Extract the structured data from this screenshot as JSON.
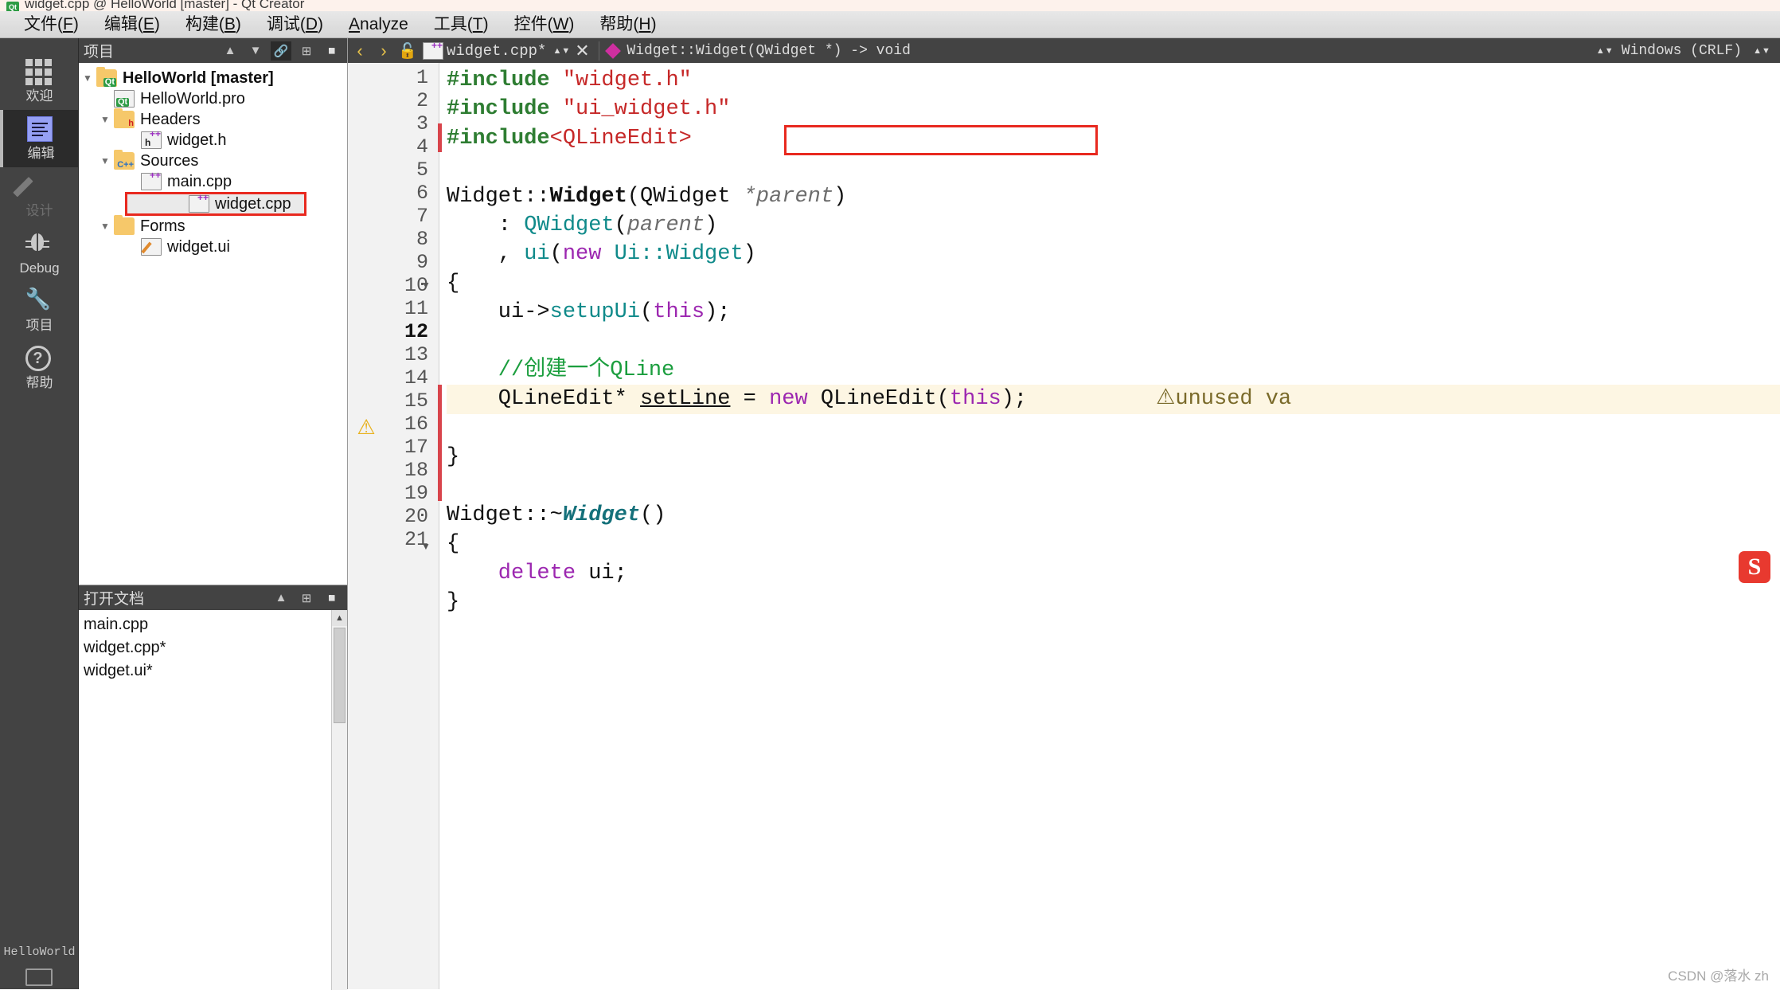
{
  "window": {
    "title": "widget.cpp @ HelloWorld [master] - Qt Creator",
    "app_icon": "qt-logo-icon"
  },
  "menubar": {
    "items": [
      {
        "label": "文件(F)",
        "mnemonic": "F"
      },
      {
        "label": "编辑(E)",
        "mnemonic": "E"
      },
      {
        "label": "构建(B)",
        "mnemonic": "B"
      },
      {
        "label": "调试(D)",
        "mnemonic": "D"
      },
      {
        "label": "Analyze",
        "mnemonic": "A"
      },
      {
        "label": "工具(T)",
        "mnemonic": "T"
      },
      {
        "label": "控件(W)",
        "mnemonic": "W"
      },
      {
        "label": "帮助(H)",
        "mnemonic": "H"
      }
    ]
  },
  "modebar": {
    "items": [
      {
        "label": "欢迎",
        "icon": "grid-icon",
        "state": "normal"
      },
      {
        "label": "编辑",
        "icon": "edit-document-icon",
        "state": "active"
      },
      {
        "label": "设计",
        "icon": "pencil-icon",
        "state": "disabled"
      },
      {
        "label": "Debug",
        "icon": "bug-icon",
        "state": "normal"
      },
      {
        "label": "项目",
        "icon": "wrench-icon",
        "state": "normal"
      },
      {
        "label": "帮助",
        "icon": "question-mark-icon",
        "state": "normal"
      }
    ],
    "kit_label": "HelloWorld"
  },
  "project_panel": {
    "header_title": "项目",
    "header_icons": [
      "updown-arrows-icon",
      "filter-icon",
      "link-icon",
      "split-icon",
      "close-panel-icon"
    ],
    "tree": [
      {
        "label": "HelloWorld [master]",
        "icon": "qt-project-folder-icon",
        "depth": 0,
        "expanded": true,
        "bold": true
      },
      {
        "label": "HelloWorld.pro",
        "icon": "qt-pro-file-icon",
        "depth": 1,
        "bold": false
      },
      {
        "label": "Headers",
        "icon": "headers-folder-icon",
        "depth": 1,
        "expanded": true,
        "bold": false
      },
      {
        "label": "widget.h",
        "icon": "h-file-icon",
        "depth": 2,
        "bold": false
      },
      {
        "label": "Sources",
        "icon": "sources-folder-icon",
        "depth": 1,
        "expanded": true,
        "bold": false
      },
      {
        "label": "main.cpp",
        "icon": "cpp-file-icon",
        "depth": 2,
        "bold": false
      },
      {
        "label": "widget.cpp",
        "icon": "cpp-file-icon",
        "depth": 2,
        "bold": false,
        "selected": true,
        "highlight_box": true
      },
      {
        "label": "Forms",
        "icon": "forms-folder-icon",
        "depth": 1,
        "expanded": true,
        "bold": false
      },
      {
        "label": "widget.ui",
        "icon": "ui-file-icon",
        "depth": 2,
        "bold": false
      }
    ]
  },
  "open_documents": {
    "header_title": "打开文档",
    "header_icons": [
      "updown-arrows-icon",
      "split-icon",
      "close-panel-icon"
    ],
    "items": [
      {
        "label": "main.cpp",
        "modified": false
      },
      {
        "label": "widget.cpp*",
        "modified": true
      },
      {
        "label": "widget.ui*",
        "modified": true
      }
    ]
  },
  "editor_toolbar": {
    "back_arrow": "‹",
    "forward_arrow": "›",
    "lock_icon": "unlock-icon",
    "file_icon": "cpp-file-icon",
    "filename": "widget.cpp*",
    "updown_icon": "updown-arrows-icon",
    "close_icon": "✕",
    "symbol_icon": "symbol-diamond-icon",
    "symbol": "Widget::Widget(QWidget *) -> void",
    "line_ending": "Windows (CRLF)"
  },
  "code": {
    "first_line": 1,
    "last_line": 21,
    "current_line": 12,
    "warning_line": 12,
    "warning_text": "unused va",
    "changed_lines": [
      3,
      10,
      11,
      12,
      13
    ],
    "fold_arrows": [
      7,
      16
    ],
    "highlight_box_line": 3,
    "lines": [
      {
        "n": 1,
        "tokens": [
          {
            "t": "#include ",
            "c": "pp"
          },
          {
            "t": "\"widget.h\"",
            "c": "str"
          }
        ]
      },
      {
        "n": 2,
        "tokens": [
          {
            "t": "#include ",
            "c": "pp"
          },
          {
            "t": "\"ui_widget.h\"",
            "c": "str"
          }
        ]
      },
      {
        "n": 3,
        "tokens": [
          {
            "t": "#include",
            "c": "pp"
          },
          {
            "t": "<QLineEdit>",
            "c": "str"
          }
        ]
      },
      {
        "n": 4,
        "tokens": []
      },
      {
        "n": 5,
        "tokens": [
          {
            "t": "Widget",
            "c": "typ"
          },
          {
            "t": "::",
            "c": "id"
          },
          {
            "t": "Widget",
            "c": "cls"
          },
          {
            "t": "(",
            "c": "id"
          },
          {
            "t": "QWidget ",
            "c": "typ"
          },
          {
            "t": "*parent",
            "c": "param"
          },
          {
            "t": ")",
            "c": "id"
          }
        ]
      },
      {
        "n": 6,
        "tokens": [
          {
            "t": "    : ",
            "c": "id"
          },
          {
            "t": "QWidget",
            "c": "fn"
          },
          {
            "t": "(",
            "c": "id"
          },
          {
            "t": "parent",
            "c": "param"
          },
          {
            "t": ")",
            "c": "id"
          }
        ]
      },
      {
        "n": 7,
        "tokens": [
          {
            "t": "    , ",
            "c": "id"
          },
          {
            "t": "ui",
            "c": "fn"
          },
          {
            "t": "(",
            "c": "id"
          },
          {
            "t": "new",
            "c": "kw"
          },
          {
            "t": " Ui::",
            "c": "fn"
          },
          {
            "t": "Widget",
            "c": "fn"
          },
          {
            "t": ")",
            "c": "id"
          }
        ]
      },
      {
        "n": 8,
        "tokens": [
          {
            "t": "{",
            "c": "id"
          }
        ]
      },
      {
        "n": 9,
        "tokens": [
          {
            "t": "    ui->",
            "c": "id"
          },
          {
            "t": "setupUi",
            "c": "fn"
          },
          {
            "t": "(",
            "c": "id"
          },
          {
            "t": "this",
            "c": "kw"
          },
          {
            "t": ");",
            "c": "id"
          }
        ]
      },
      {
        "n": 10,
        "tokens": []
      },
      {
        "n": 11,
        "tokens": [
          {
            "t": "    //创建一个QLine",
            "c": "cmt"
          }
        ]
      },
      {
        "n": 12,
        "tokens": [
          {
            "t": "    QLineEdit* ",
            "c": "id"
          },
          {
            "t": "setLine",
            "c": "fld"
          },
          {
            "t": " = ",
            "c": "id"
          },
          {
            "t": "new",
            "c": "kw"
          },
          {
            "t": " QLineEdit(",
            "c": "id"
          },
          {
            "t": "this",
            "c": "kw"
          },
          {
            "t": ");",
            "c": "id"
          }
        ]
      },
      {
        "n": 13,
        "tokens": []
      },
      {
        "n": 14,
        "tokens": [
          {
            "t": "}",
            "c": "id"
          }
        ]
      },
      {
        "n": 15,
        "tokens": []
      },
      {
        "n": 16,
        "tokens": [
          {
            "t": "Widget",
            "c": "typ"
          },
          {
            "t": "::~",
            "c": "id"
          },
          {
            "t": "Widget",
            "c": "italbold"
          },
          {
            "t": "()",
            "c": "id"
          }
        ]
      },
      {
        "n": 17,
        "tokens": [
          {
            "t": "{",
            "c": "id"
          }
        ]
      },
      {
        "n": 18,
        "tokens": [
          {
            "t": "    delete",
            "c": "kw"
          },
          {
            "t": " ui;",
            "c": "id"
          }
        ]
      },
      {
        "n": 19,
        "tokens": [
          {
            "t": "}",
            "c": "id"
          }
        ]
      },
      {
        "n": 20,
        "tokens": []
      },
      {
        "n": 21,
        "tokens": []
      }
    ]
  },
  "overlays": {
    "sogou_logo": "S",
    "watermark": "CSDN @落水 zh"
  },
  "colors": {
    "accent_blue": "#96a0f5",
    "highlight_red": "#e8291f",
    "warning_yellow": "#e8b11c",
    "comment_green": "#1b9e3e",
    "string_red": "#c62828",
    "preproc_green": "#2e7d32",
    "keyword_purple": "#9c27b0",
    "panel_dark": "#434343"
  }
}
